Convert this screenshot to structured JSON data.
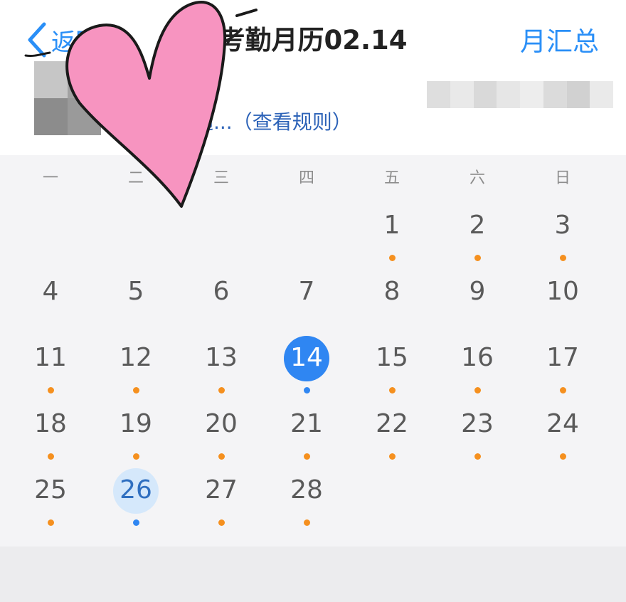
{
  "header": {
    "back_label": "返回",
    "title": "考勤月历02.14",
    "summary_label": "月汇总",
    "rule_text": "通...（查看规则）"
  },
  "weekdays": [
    "一",
    "二",
    "三",
    "四",
    "五",
    "六",
    "日"
  ],
  "days": [
    {
      "n": "1",
      "col": 4,
      "row": 0,
      "dot": "orange"
    },
    {
      "n": "2",
      "col": 5,
      "row": 0,
      "dot": "orange"
    },
    {
      "n": "3",
      "col": 6,
      "row": 0,
      "dot": "orange"
    },
    {
      "n": "4",
      "col": 0,
      "row": 1,
      "dot": ""
    },
    {
      "n": "5",
      "col": 1,
      "row": 1,
      "dot": ""
    },
    {
      "n": "6",
      "col": 2,
      "row": 1,
      "dot": ""
    },
    {
      "n": "7",
      "col": 3,
      "row": 1,
      "dot": ""
    },
    {
      "n": "8",
      "col": 4,
      "row": 1,
      "dot": ""
    },
    {
      "n": "9",
      "col": 5,
      "row": 1,
      "dot": ""
    },
    {
      "n": "10",
      "col": 6,
      "row": 1,
      "dot": ""
    },
    {
      "n": "11",
      "col": 0,
      "row": 2,
      "dot": "orange"
    },
    {
      "n": "12",
      "col": 1,
      "row": 2,
      "dot": "orange"
    },
    {
      "n": "13",
      "col": 2,
      "row": 2,
      "dot": "orange"
    },
    {
      "n": "14",
      "col": 3,
      "row": 2,
      "dot": "blue",
      "state": "today"
    },
    {
      "n": "15",
      "col": 4,
      "row": 2,
      "dot": "orange"
    },
    {
      "n": "16",
      "col": 5,
      "row": 2,
      "dot": "orange"
    },
    {
      "n": "17",
      "col": 6,
      "row": 2,
      "dot": "orange"
    },
    {
      "n": "18",
      "col": 0,
      "row": 3,
      "dot": "orange"
    },
    {
      "n": "19",
      "col": 1,
      "row": 3,
      "dot": "orange"
    },
    {
      "n": "20",
      "col": 2,
      "row": 3,
      "dot": "orange"
    },
    {
      "n": "21",
      "col": 3,
      "row": 3,
      "dot": "orange"
    },
    {
      "n": "22",
      "col": 4,
      "row": 3,
      "dot": "orange"
    },
    {
      "n": "23",
      "col": 5,
      "row": 3,
      "dot": "orange"
    },
    {
      "n": "24",
      "col": 6,
      "row": 3,
      "dot": "orange"
    },
    {
      "n": "25",
      "col": 0,
      "row": 4,
      "dot": "orange"
    },
    {
      "n": "26",
      "col": 1,
      "row": 4,
      "dot": "blue",
      "state": "selected"
    },
    {
      "n": "27",
      "col": 2,
      "row": 4,
      "dot": "orange"
    },
    {
      "n": "28",
      "col": 3,
      "row": 4,
      "dot": "orange"
    }
  ],
  "colors": {
    "accent": "#2a8ff7",
    "today": "#2f86f2",
    "selected_bg": "#d5e8fb",
    "attendance_dot": "#f5901f",
    "heart_fill": "#f794c0"
  },
  "icons": {
    "back": "chevron-left-icon",
    "sticker": "heart-sticker"
  }
}
